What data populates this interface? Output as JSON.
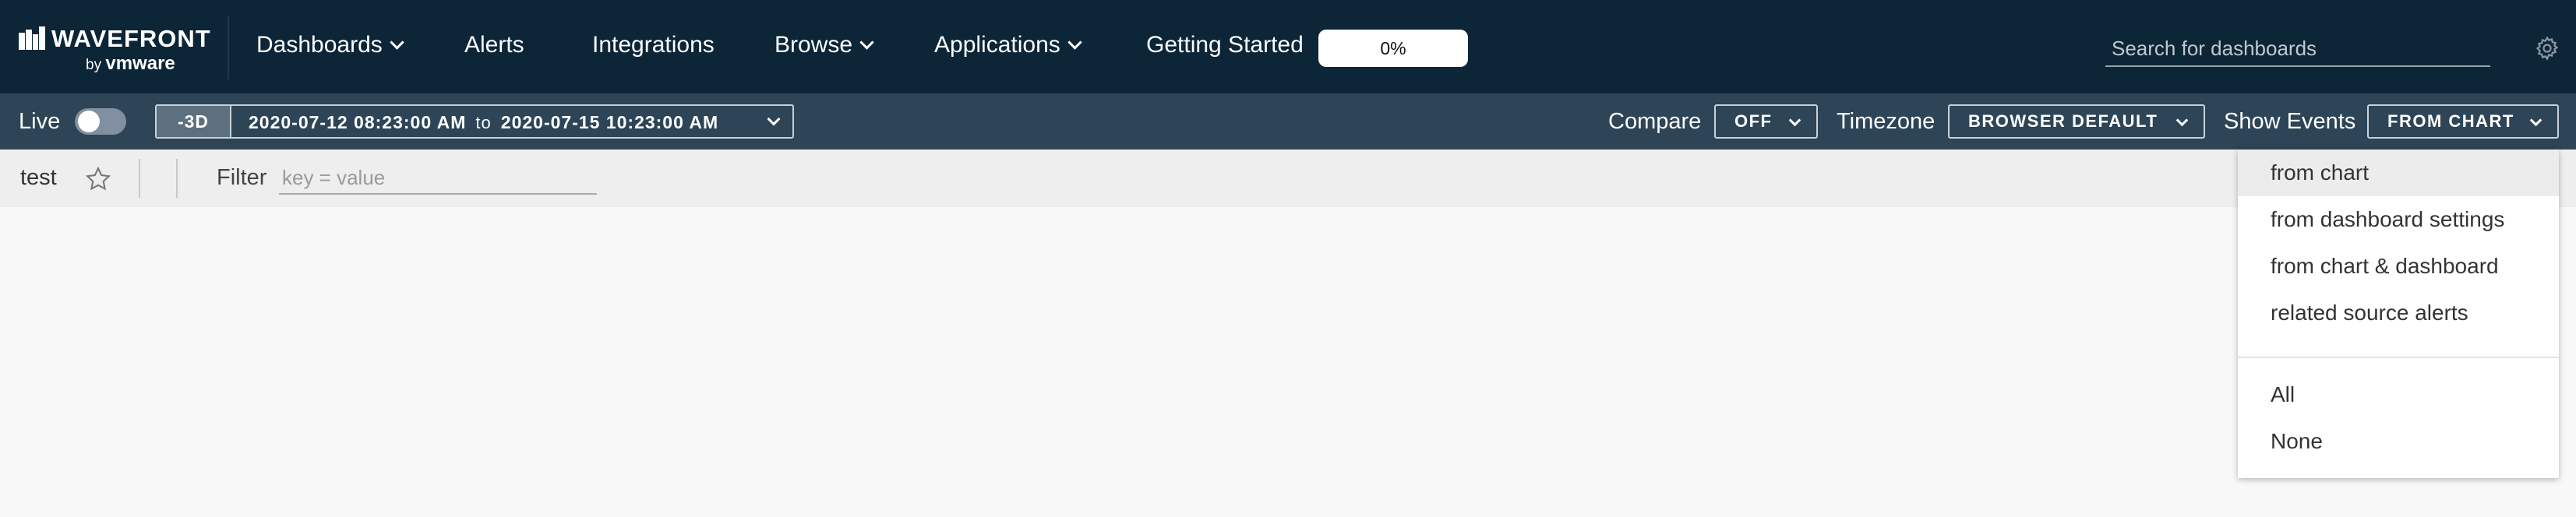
{
  "brand": {
    "name": "WAVEFRONT",
    "by": "by",
    "vendor": "vmware"
  },
  "nav": {
    "items": [
      {
        "label": "Dashboards",
        "dropdown": true
      },
      {
        "label": "Alerts",
        "dropdown": false
      },
      {
        "label": "Integrations",
        "dropdown": false
      },
      {
        "label": "Browse",
        "dropdown": true
      },
      {
        "label": "Applications",
        "dropdown": true
      }
    ],
    "getting_started": {
      "label": "Getting Started",
      "progress_text": "0%",
      "progress_value": 0
    },
    "search_placeholder": "Search for dashboards",
    "settings_icon": "gear-icon"
  },
  "toolbar": {
    "live_label": "Live",
    "live_on": false,
    "range_preset": "-3D",
    "range_start": "2020-07-12 08:23:00 AM",
    "range_to": "to",
    "range_end": "2020-07-15 10:23:00 AM",
    "compare_label": "Compare",
    "compare_value": "OFF",
    "timezone_label": "Timezone",
    "timezone_value": "BROWSER DEFAULT",
    "events_label": "Show Events",
    "events_value": "FROM CHART"
  },
  "filterbar": {
    "dashboard_title": "test",
    "filter_label": "Filter",
    "filter_placeholder": "key = value"
  },
  "events_menu": {
    "items": [
      "from chart",
      "from dashboard settings",
      "from chart & dashboard",
      "related source alerts"
    ],
    "selected": "from chart",
    "extra_items": [
      "All",
      "None"
    ]
  },
  "colors": {
    "topbar": "#0c2537",
    "toolbar": "#2d4556",
    "filterbar": "#eeeeee",
    "canvas": "#f8f8f8"
  }
}
